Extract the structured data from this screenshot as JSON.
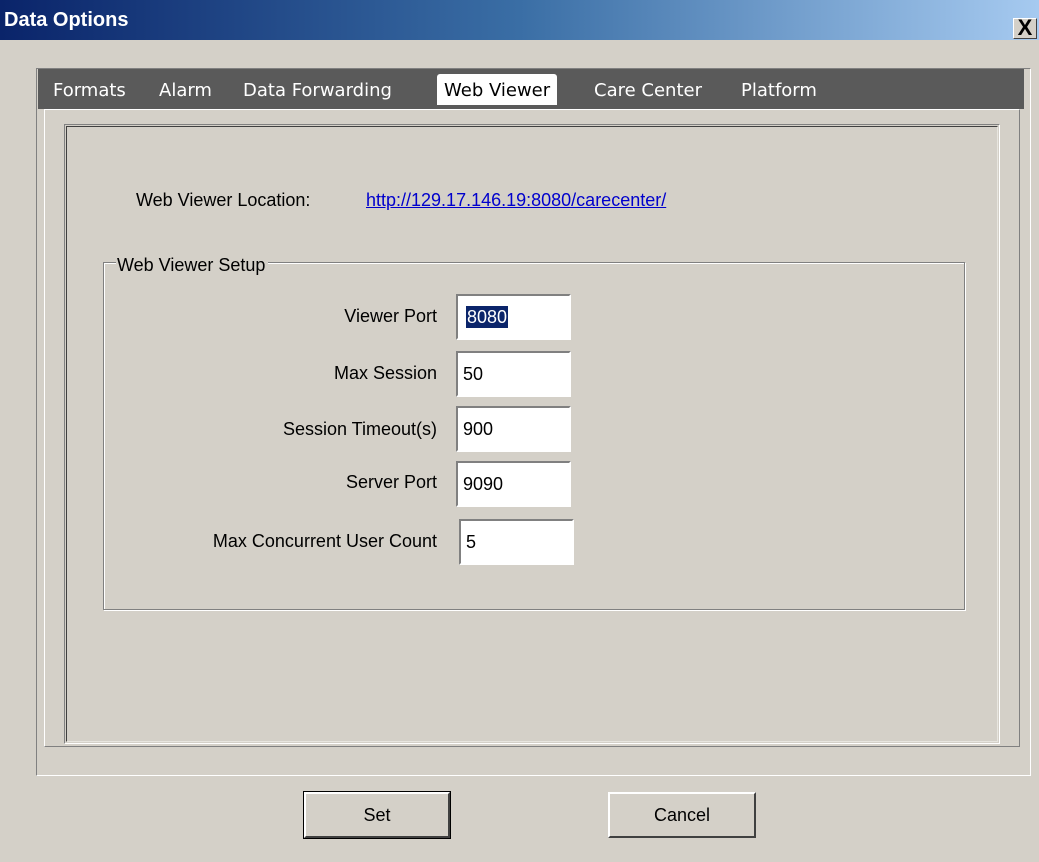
{
  "window": {
    "title": "Data Options",
    "close_label": "X"
  },
  "tabs": [
    {
      "label": "Formats",
      "active": false
    },
    {
      "label": "Alarm",
      "active": false
    },
    {
      "label": "Data Forwarding",
      "active": false
    },
    {
      "label": "Web Viewer",
      "active": true
    },
    {
      "label": "Care Center",
      "active": false
    },
    {
      "label": "Platform",
      "active": false
    }
  ],
  "web_viewer": {
    "location_label": "Web Viewer Location:",
    "location_url": "http://129.17.146.19:8080/carecenter/",
    "setup_group_title": "Web Viewer Setup",
    "fields": [
      {
        "label": "Viewer Port",
        "value": "8080"
      },
      {
        "label": "Max Session",
        "value": "50"
      },
      {
        "label": "Session Timeout(s)",
        "value": "900"
      },
      {
        "label": "Server Port",
        "value": "9090"
      },
      {
        "label": "Max Concurrent User Count",
        "value": "5"
      }
    ]
  },
  "buttons": {
    "set_label": "Set",
    "cancel_label": "Cancel"
  },
  "colors": {
    "titlebar_start": "#0a246a",
    "titlebar_end": "#a6caf0",
    "dialog_bg": "#d4d0c8",
    "tabstrip_bg": "#5a5a5a",
    "link": "#0000cc",
    "selection": "#0a246a"
  }
}
